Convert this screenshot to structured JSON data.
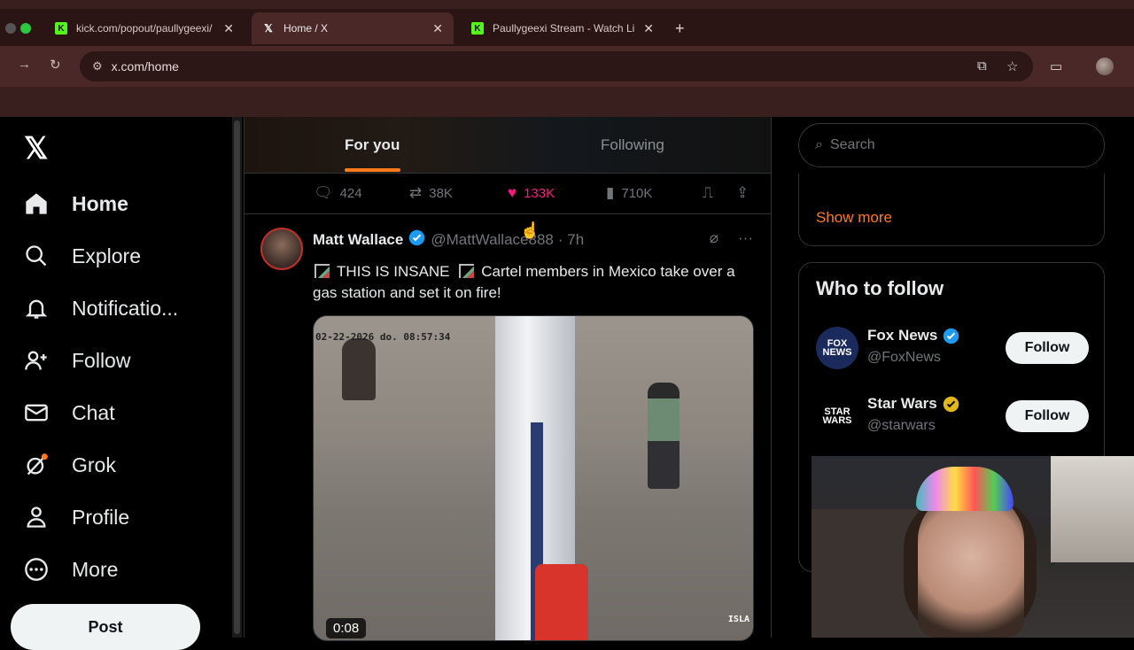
{
  "browser": {
    "tabs": [
      {
        "title": "kick.com/popout/paullygeexi/",
        "favicon": "kick-icon"
      },
      {
        "title": "Home / X",
        "favicon": "x-icon"
      },
      {
        "title": "Paullygeexi Stream - Watch Li",
        "favicon": "kick-icon"
      }
    ],
    "url": "x.com/home"
  },
  "sidebar": {
    "items": [
      {
        "label": "Home",
        "icon": "home-icon"
      },
      {
        "label": "Explore",
        "icon": "search-icon"
      },
      {
        "label": "Notificatio...",
        "icon": "bell-icon"
      },
      {
        "label": "Follow",
        "icon": "add-person-icon"
      },
      {
        "label": "Chat",
        "icon": "envelope-icon"
      },
      {
        "label": "Grok",
        "icon": "grok-icon"
      },
      {
        "label": "Profile",
        "icon": "person-icon"
      },
      {
        "label": "More",
        "icon": "more-circle-icon"
      }
    ],
    "post_label": "Post"
  },
  "feed": {
    "tabs": [
      "For you",
      "Following"
    ],
    "prev_actions": {
      "replies": "424",
      "reposts": "38K",
      "likes": "133K",
      "views": "710K"
    },
    "tweet": {
      "author": "Matt Wallace",
      "handle": "@MattWallace888",
      "time": "· 7h",
      "text_part1": "THIS IS INSANE",
      "text_part2": "Cartel members in Mexico take over a gas station and set it on fire!",
      "media_timestamp": "02-22-2026 do.   08:57:34",
      "media_watermark": "ISLA",
      "duration": "0:08"
    }
  },
  "right": {
    "search_placeholder": "Search",
    "show_more": "Show more",
    "who_to_follow": "Who to follow",
    "suggestions": [
      {
        "name": "Fox News",
        "handle": "@FoxNews",
        "button": "Follow",
        "badge_color": "#1d9bf0"
      },
      {
        "name": "Star Wars",
        "handle": "@starwars",
        "button": "Follow",
        "badge_color": "#e2b719"
      }
    ]
  },
  "colors": {
    "accent": "#ff7a1a",
    "like": "#f91880",
    "verified": "#1d9bf0"
  }
}
